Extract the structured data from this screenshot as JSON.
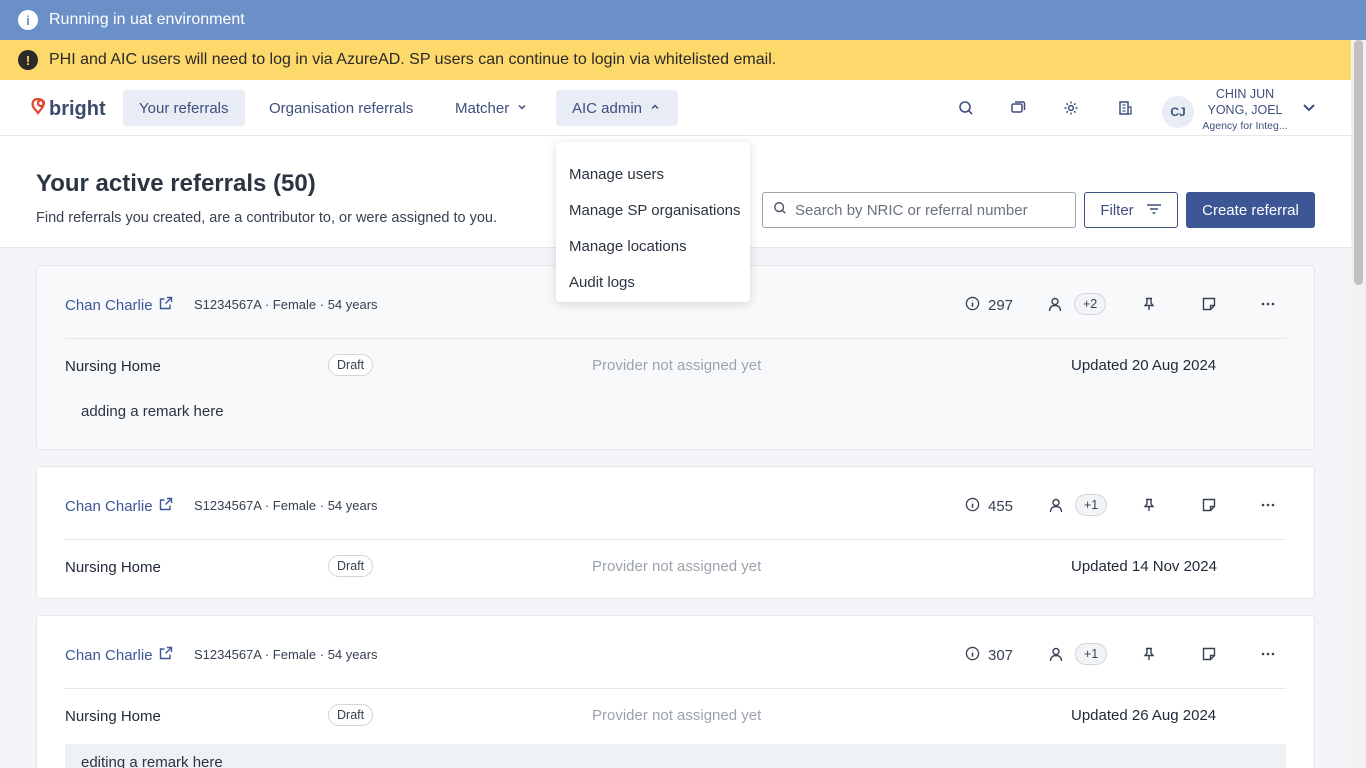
{
  "banners": {
    "env": {
      "icon": "info-icon",
      "text": "Running in uat environment"
    },
    "warning": {
      "icon": "exclamation-icon",
      "text": "PHI and AIC users will need to log in via AzureAD. SP users can continue to login via whitelisted email."
    }
  },
  "nav": {
    "logo": "bright",
    "items": [
      "Your referrals",
      "Organisation referrals",
      "Matcher",
      "AIC admin"
    ],
    "icons": [
      "search-icon",
      "messages-icon",
      "gear-icon",
      "building-icon"
    ],
    "user": {
      "initials": "CJ",
      "name": "CHIN JUN YONG, JOEL",
      "org": "Agency for Integ..."
    }
  },
  "dropdown": {
    "items": [
      "Manage users",
      "Manage SP organisations",
      "Manage locations",
      "Audit logs"
    ]
  },
  "header": {
    "title": "Your active referrals (50)",
    "subtitle": "Find referrals you created, are a contributor to, or were assigned to you.",
    "search_placeholder": "Search by NRIC or referral number",
    "filter_label": "Filter",
    "create_label": "Create referral"
  },
  "referrals": [
    {
      "name": "Chan Charlie",
      "meta": "S1234567A · Female · 54 years",
      "count": "297",
      "contributors": "+2",
      "type": "Nursing Home",
      "status": "Draft",
      "provider": "Provider not assigned yet",
      "updated": "Updated 20 Aug 2024",
      "remark": "adding a remark here"
    },
    {
      "name": "Chan Charlie",
      "meta": "S1234567A · Female · 54 years",
      "count": "455",
      "contributors": "+1",
      "type": "Nursing Home",
      "status": "Draft",
      "provider": "Provider not assigned yet",
      "updated": "Updated 14 Nov 2024",
      "remark": ""
    },
    {
      "name": "Chan Charlie",
      "meta": "S1234567A · Female · 54 years",
      "count": "307",
      "contributors": "+1",
      "type": "Nursing Home",
      "status": "Draft",
      "provider": "Provider not assigned yet",
      "updated": "Updated 26 Aug 2024",
      "remark": "editing a remark here"
    }
  ],
  "colors": {
    "env_banner": "#6b8fc7",
    "warn_banner": "#fdd86a",
    "primary": "#3d5796",
    "logo_mark": "#e2442f"
  }
}
